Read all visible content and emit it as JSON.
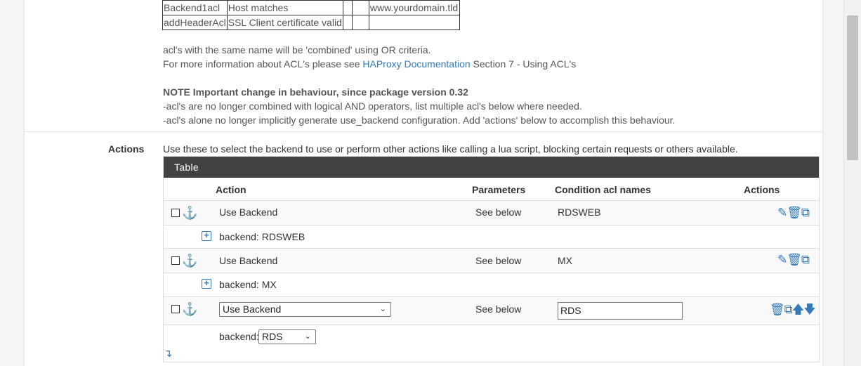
{
  "acl_table": {
    "rows": [
      [
        "Backend1acl",
        "Host matches",
        "",
        "",
        "www.yourdomain.tld"
      ],
      [
        "addHeaderAcl",
        "SSL Client certificate valid",
        "",
        "",
        ""
      ]
    ]
  },
  "notes": {
    "combined": "acl's with the same name will be 'combined' using OR criteria.",
    "more_info_prefix": "For more information about ACL's please see ",
    "more_info_link": "HAProxy Documentation",
    "more_info_suffix": " Section 7 - Using ACL's",
    "note_title": "NOTE Important change in behaviour, since package version 0.32",
    "note_line1": "-acl's are no longer combined with logical AND operators, list multiple acl's below where needed.",
    "note_line2": "-acl's alone no longer implicitly generate use_backend configuration. Add 'actions' below to accomplish this behaviour."
  },
  "actions_section": {
    "label": "Actions",
    "description": "Use these to select the backend to use or perform other actions like calling a lua script, blocking certain requests or others available.",
    "table_title": "Table",
    "columns": {
      "action": "Action",
      "parameters": "Parameters",
      "condition": "Condition acl names",
      "actions": "Actions"
    },
    "rows": [
      {
        "action": "Use Backend",
        "parameters": "See below",
        "condition": "RDSWEB",
        "detail": "backend: RDSWEB"
      },
      {
        "action": "Use Backend",
        "parameters": "See below",
        "condition": "MX",
        "detail": "backend: MX"
      }
    ],
    "edit_row": {
      "action_value": "Use Backend",
      "parameters": "See below",
      "condition_value": "RDS",
      "backend_label": "backend:",
      "backend_value": "RDS"
    }
  },
  "icons": {
    "anchor": "anchor-icon",
    "edit": "pencil-icon",
    "delete": "trash-icon",
    "copy": "copy-icon",
    "expand": "plus-square-icon",
    "move_up": "arrow-up-icon",
    "move_down": "arrow-down-icon",
    "insert": "insert-arrow-icon"
  },
  "colors": {
    "link": "#337ab7",
    "table_header_bg": "#424242"
  }
}
